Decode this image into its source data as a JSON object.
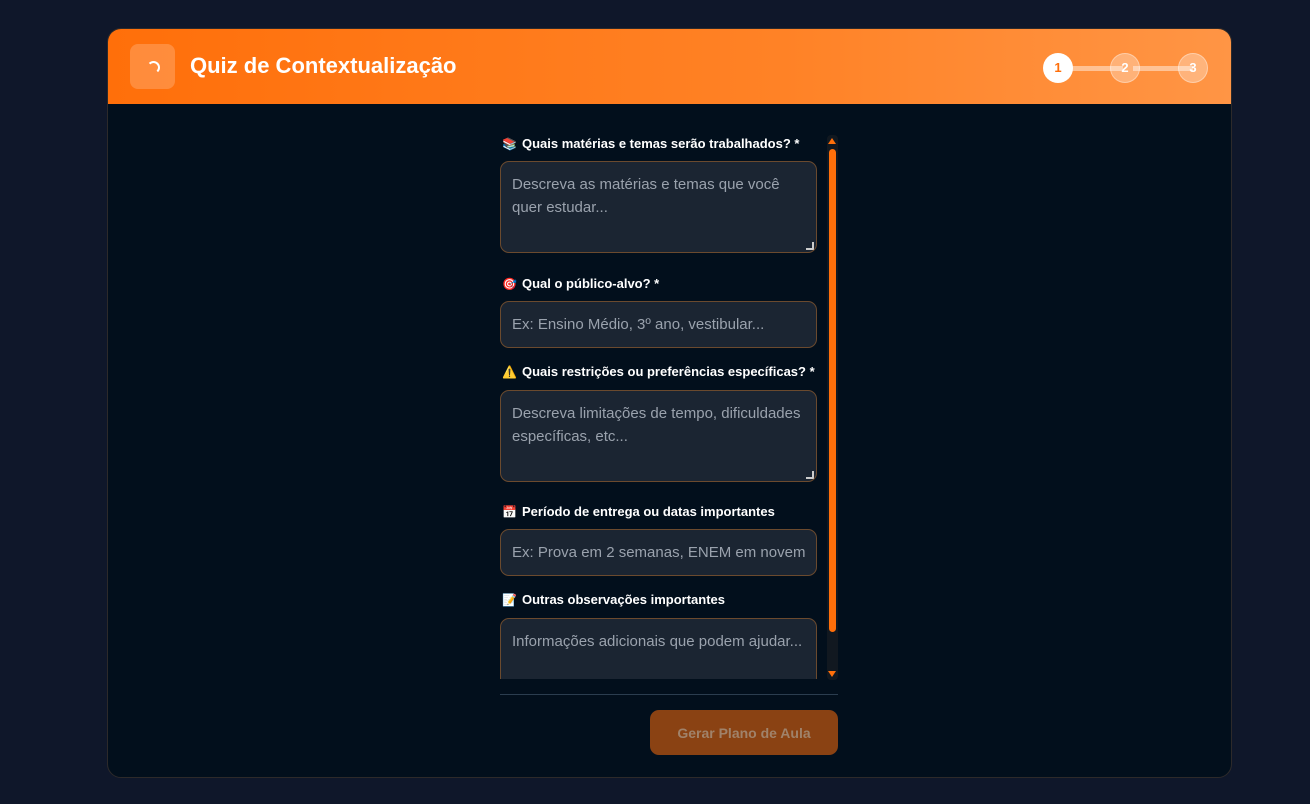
{
  "header": {
    "title": "Quiz de Contextualização",
    "steps": [
      "1",
      "2",
      "3"
    ],
    "active_step": 1,
    "accent_color": "#ff6f0a"
  },
  "form": {
    "fields": [
      {
        "label": "Quais matérias e temas serão trabalhados? *",
        "icon": "books-icon",
        "icon_glyph": "📚",
        "placeholder": "Descreva as matérias e temas que você quer estudar...",
        "type": "textarea"
      },
      {
        "label": "Qual o público-alvo? *",
        "icon": "target-icon",
        "icon_glyph": "🎯",
        "placeholder": "Ex: Ensino Médio, 3º ano, vestibular...",
        "type": "input"
      },
      {
        "label": "Quais restrições ou preferências específicas? *",
        "icon": "warning-icon",
        "icon_glyph": "⚠️",
        "placeholder": "Descreva limitações de tempo, dificuldades específicas, etc...",
        "type": "textarea"
      },
      {
        "label": "Período de entrega ou datas importantes",
        "icon": "calendar-icon",
        "icon_glyph": "📅",
        "placeholder": "Ex: Prova em 2 semanas, ENEM em novem",
        "type": "input"
      },
      {
        "label": "Outras observações importantes",
        "icon": "memo-icon",
        "icon_glyph": "📝",
        "placeholder": "Informações adicionais que podem ajudar...",
        "type": "textarea"
      }
    ],
    "submit_label": "Gerar Plano de Aula"
  }
}
